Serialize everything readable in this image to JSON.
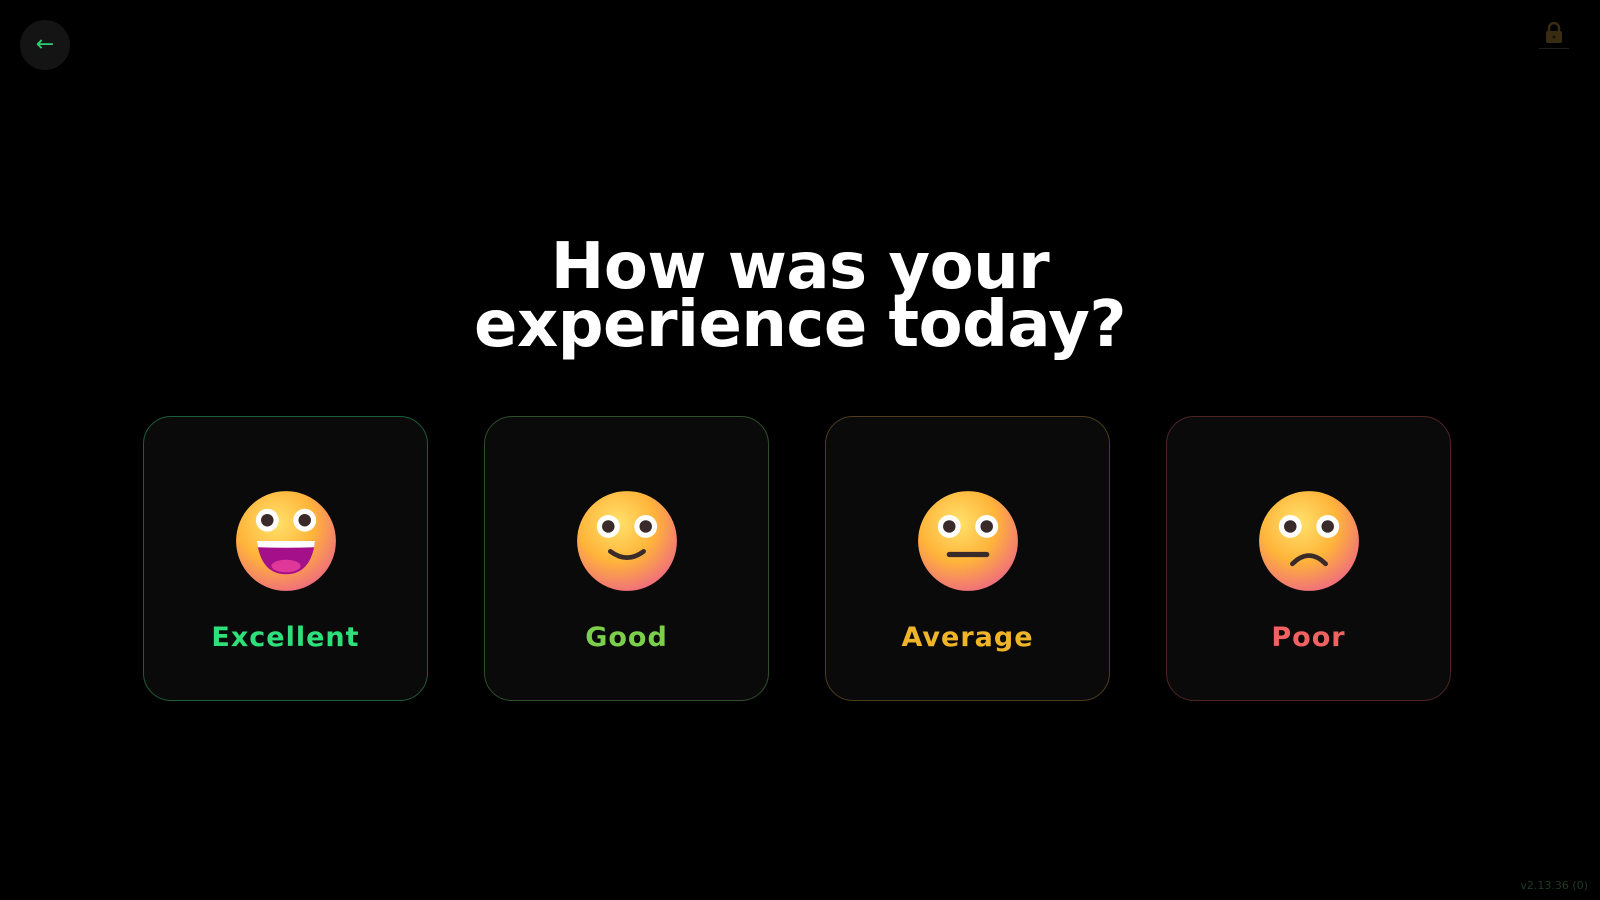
{
  "nav": {
    "back_glyph": "←",
    "back_icon": "arrow-left-icon",
    "lock_icon": "lock-icon"
  },
  "question": {
    "line1": "How was your",
    "line2": "experience today?"
  },
  "options": [
    {
      "label": "Excellent",
      "face": "grinning-face",
      "color": "#2ee07a",
      "border": "#1c5c3a"
    },
    {
      "label": "Good",
      "face": "slightly-smiling-face",
      "color": "#7ccf4a",
      "border": "#2f4e2a"
    },
    {
      "label": "Average",
      "face": "neutral-face",
      "color": "#f0b429",
      "border": "#4e3d1c"
    },
    {
      "label": "Poor",
      "face": "frowning-face",
      "color": "#f06262",
      "border": "#4e2424"
    }
  ],
  "footer": {
    "version": "v2.13.36 (0)"
  },
  "colors": {
    "background": "#000000",
    "card_background": "#0a0a0a",
    "accent": "#2ecc71"
  }
}
